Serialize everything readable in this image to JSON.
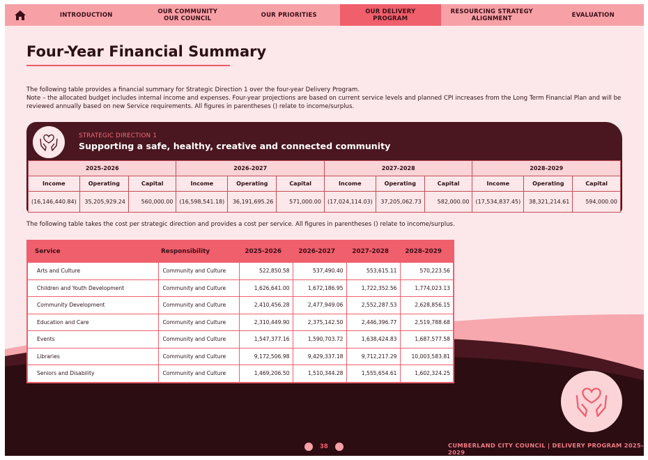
{
  "nav": {
    "items": [
      {
        "label": "INTRODUCTION",
        "active": false
      },
      {
        "label": "OUR COMMUNITY\nOUR COUNCIL",
        "active": false
      },
      {
        "label": "OUR PRIORITIES",
        "active": false
      },
      {
        "label": "OUR DELIVERY\nPROGRAM",
        "active": true
      },
      {
        "label": "RESOURCING STRATEGY\nALIGNMENT",
        "active": false
      },
      {
        "label": "EVALUATION",
        "active": false
      }
    ]
  },
  "page": {
    "title": "Four-Year Financial Summary",
    "intro": "The following table provides a financial summary for Strategic Direction 1 over the four-year Delivery Program.",
    "note": "Note – the allocated budget includes internal income and expenses. Four-year projections are based on current service levels and planned CPI increases from the Long Term Financial Plan and will be reviewed annually based on new Service requirements. All figures in parentheses () relate to income/surplus.",
    "intro2": "The following table takes the cost per strategic direction and provides a cost per service. All figures in parentheses () relate to income/surplus."
  },
  "strategic_direction": {
    "label": "STRATEGIC DIRECTION 1",
    "title": "Supporting a safe, healthy, creative and connected community"
  },
  "financial": {
    "years": [
      "2025-2026",
      "2026-2027",
      "2027-2028",
      "2028-2029"
    ],
    "headers": [
      "Income",
      "Operating",
      "Capital"
    ],
    "values": [
      [
        "(16,146,440.84)",
        "35,205,929.24",
        "560,000.00"
      ],
      [
        "(16,598,541.18)",
        "36,191,695.26",
        "571,000.00"
      ],
      [
        "(17,024,114.03)",
        "37,205,062.73",
        "582,000.00"
      ],
      [
        "(17,534,837.45)",
        "38,321,214.61",
        "594,000.00"
      ]
    ]
  },
  "services": {
    "headers": [
      "Service",
      "Responsibility",
      "2025-2026",
      "2026-2027",
      "2027-2028",
      "2028-2029"
    ],
    "rows": [
      [
        "Arts and Culture",
        "Community and Culture",
        "522,850.58",
        "537,490.40",
        "553,615.11",
        "570,223.56"
      ],
      [
        "Children and Youth Development",
        "Community and Culture",
        "1,626,641.00",
        "1,672,186.95",
        "1,722,352.56",
        "1,774,023.13"
      ],
      [
        "Community Development",
        "Community and Culture",
        "2,410,456.28",
        "2,477,949.06",
        "2,552,287.53",
        "2,628,856.15"
      ],
      [
        "Education and Care",
        "Community and Culture",
        "2,310,449.90",
        "2,375,142.50",
        "2,446,396.77",
        "2,519,788.68"
      ],
      [
        "Events",
        "Community and Culture",
        "1,547,377.16",
        "1,590,703.72",
        "1,638,424.83",
        "1,687,577.58"
      ],
      [
        "Libraries",
        "Community and Culture",
        "9,172,506.98",
        "9,429,337.18",
        "9,712,217.29",
        "10,003,583.81"
      ],
      [
        "Seniors and Disability",
        "Community and Culture",
        "1,469,206.50",
        "1,510,344.28",
        "1,555,654.61",
        "1,602,324.25"
      ]
    ]
  },
  "footer": {
    "page_number": "38",
    "text": "CUMBERLAND CITY COUNCIL  |  DELIVERY PROGRAM 2025-2029"
  },
  "icons": {
    "home": "home-icon",
    "sd": "heart-hands-icon",
    "decor": "heart-hands-icon"
  },
  "colors": {
    "accent": "#ef5f6c",
    "nav": "#f7a1a7",
    "dark": "#4a1720",
    "page_bg": "#fce8ea"
  }
}
